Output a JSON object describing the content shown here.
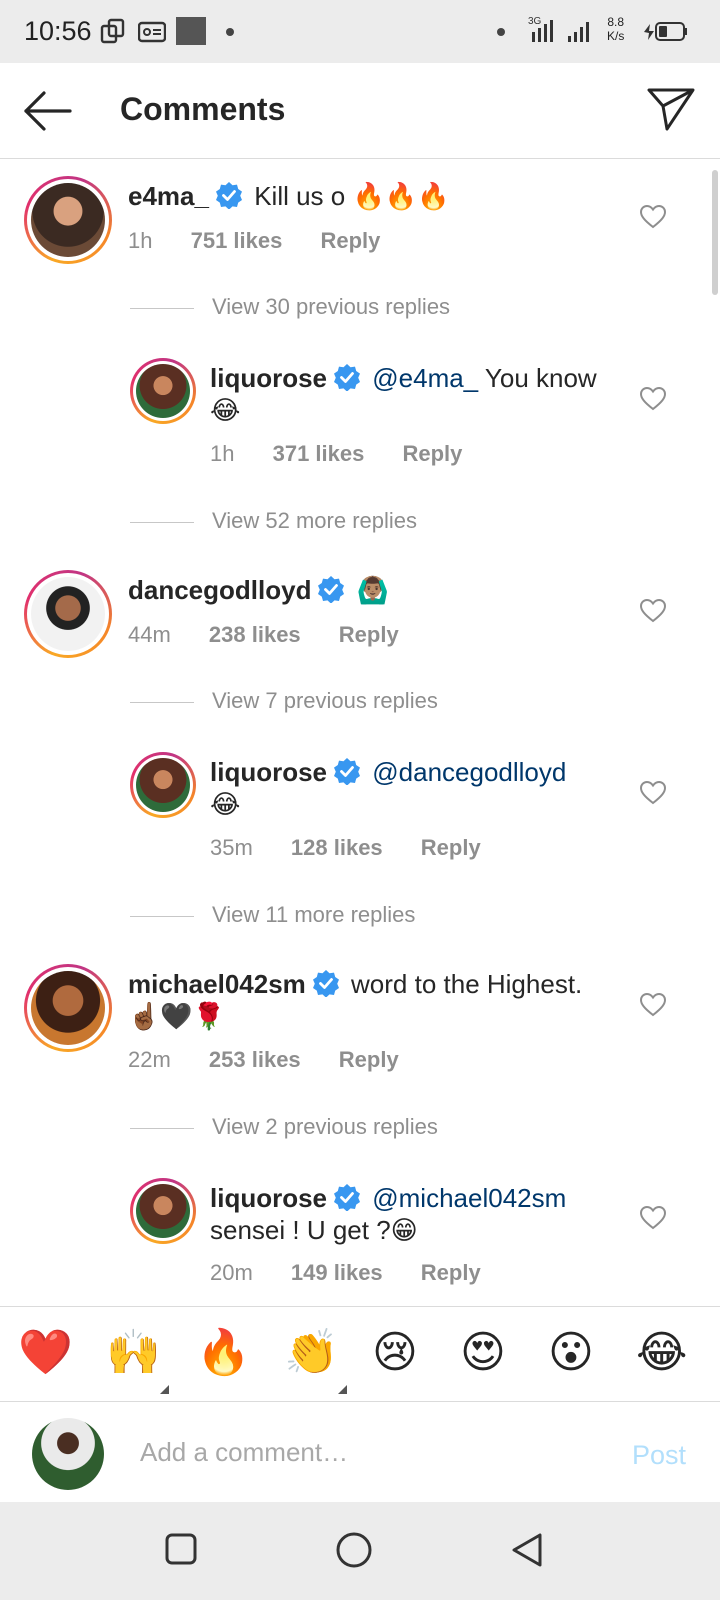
{
  "status_bar": {
    "time": "10:56",
    "speed_value": "8.8",
    "speed_unit": "K/s"
  },
  "header": {
    "title": "Comments"
  },
  "comments": [
    {
      "username": "e4ma_",
      "text": "Kill us o 🔥🔥🔥",
      "time": "1h",
      "likes": "751 likes",
      "reply": "Reply",
      "view_more": "View 30 previous replies"
    },
    {
      "username": "liquorose",
      "mention": "@e4ma_",
      "text": " You know",
      "text2": "😂",
      "time": "1h",
      "likes": "371 likes",
      "reply": "Reply",
      "view_more": "View 52 more replies"
    },
    {
      "username": "dancegodlloyd",
      "text": "🙆🏽‍♂️",
      "time": "44m",
      "likes": "238 likes",
      "reply": "Reply",
      "view_more": "View 7 previous replies"
    },
    {
      "username": "liquorose",
      "mention": "@dancegodlloyd",
      "text": "",
      "text2": "😂",
      "time": "35m",
      "likes": "128 likes",
      "reply": "Reply",
      "view_more": "View 11 more replies"
    },
    {
      "username": "michael042sm",
      "text": "word to the Highest.",
      "text2": "☝🏾🖤🌹",
      "time": "22m",
      "likes": "253 likes",
      "reply": "Reply",
      "view_more": "View 2 previous replies"
    },
    {
      "username": "liquorose",
      "mention": "@michael042sm",
      "text": "",
      "text2": "sensei ! U get ?😁",
      "time": "20m",
      "likes": "149 likes",
      "reply": "Reply"
    }
  ],
  "reactions": [
    "❤️",
    "🙌",
    "🔥",
    "👏",
    "😢",
    "😍",
    "😮",
    "😂"
  ],
  "composer": {
    "placeholder": "Add a comment…",
    "post_label": "Post"
  },
  "colors": {
    "accent_blue": "#0095f6",
    "verified_blue": "#3897f0",
    "muted_gray": "#8e8e8e",
    "post_disabled": "#b2dffc"
  }
}
